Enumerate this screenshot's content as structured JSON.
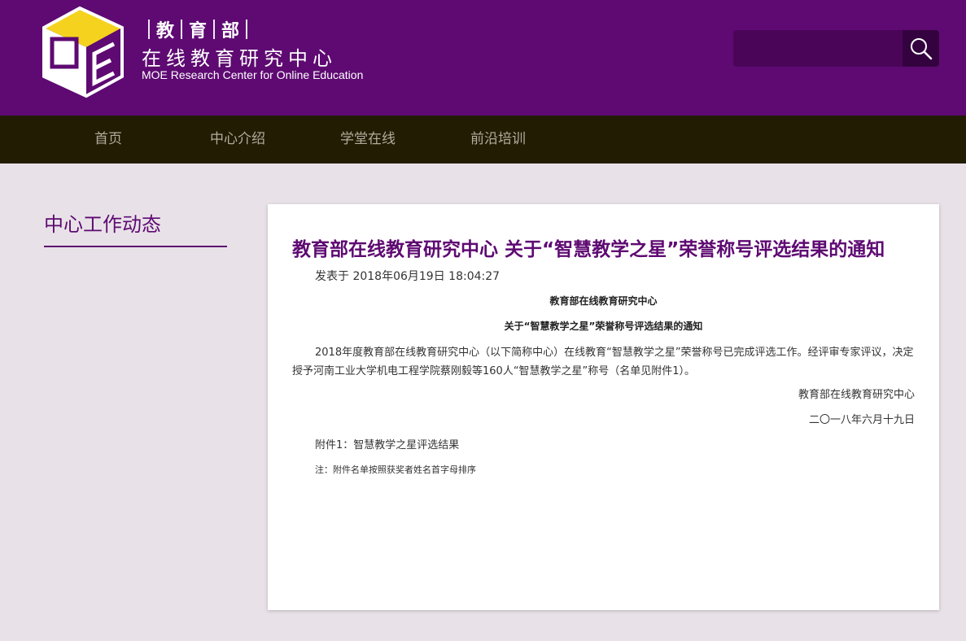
{
  "header": {
    "logo_cn_parts": [
      "教",
      "育",
      "部"
    ],
    "logo_cn_main": "在线教育研究中心",
    "logo_en": "MOE Research Center for Online Education",
    "logo_icon": "moe-logo-icon",
    "brand_color": "#5e0a72",
    "accent_color": "#f5d21e"
  },
  "search": {
    "value": "",
    "icon": "search-icon"
  },
  "nav": {
    "items": [
      {
        "label": "首页"
      },
      {
        "label": "中心介绍"
      },
      {
        "label": "学堂在线"
      },
      {
        "label": "前沿培训"
      }
    ]
  },
  "sidebar": {
    "title": "中心工作动态"
  },
  "article": {
    "title": "教育部在线教育研究中心 关于“智慧教学之星”荣誉称号评选结果的通知",
    "meta": "发表于 2018年06月19日 18:04:27",
    "heading_org": "教育部在线教育研究中心",
    "heading_subject": "关于“智慧教学之星”荣誉称号评选结果的通知",
    "body": "2018年度教育部在线教育研究中心（以下简称中心）在线教育“智慧教学之星”荣誉称号已完成评选工作。经评审专家评议，决定授予河南工业大学机电工程学院蔡刚毅等160人“智慧教学之星”称号（名单见附件1）。",
    "signature_org": "教育部在线教育研究中心",
    "signature_date": "二〇一八年六月十九日",
    "attachment": "附件1：智慧教学之星评选结果",
    "note": "注：附件名单按照获奖者姓名首字母排序"
  }
}
